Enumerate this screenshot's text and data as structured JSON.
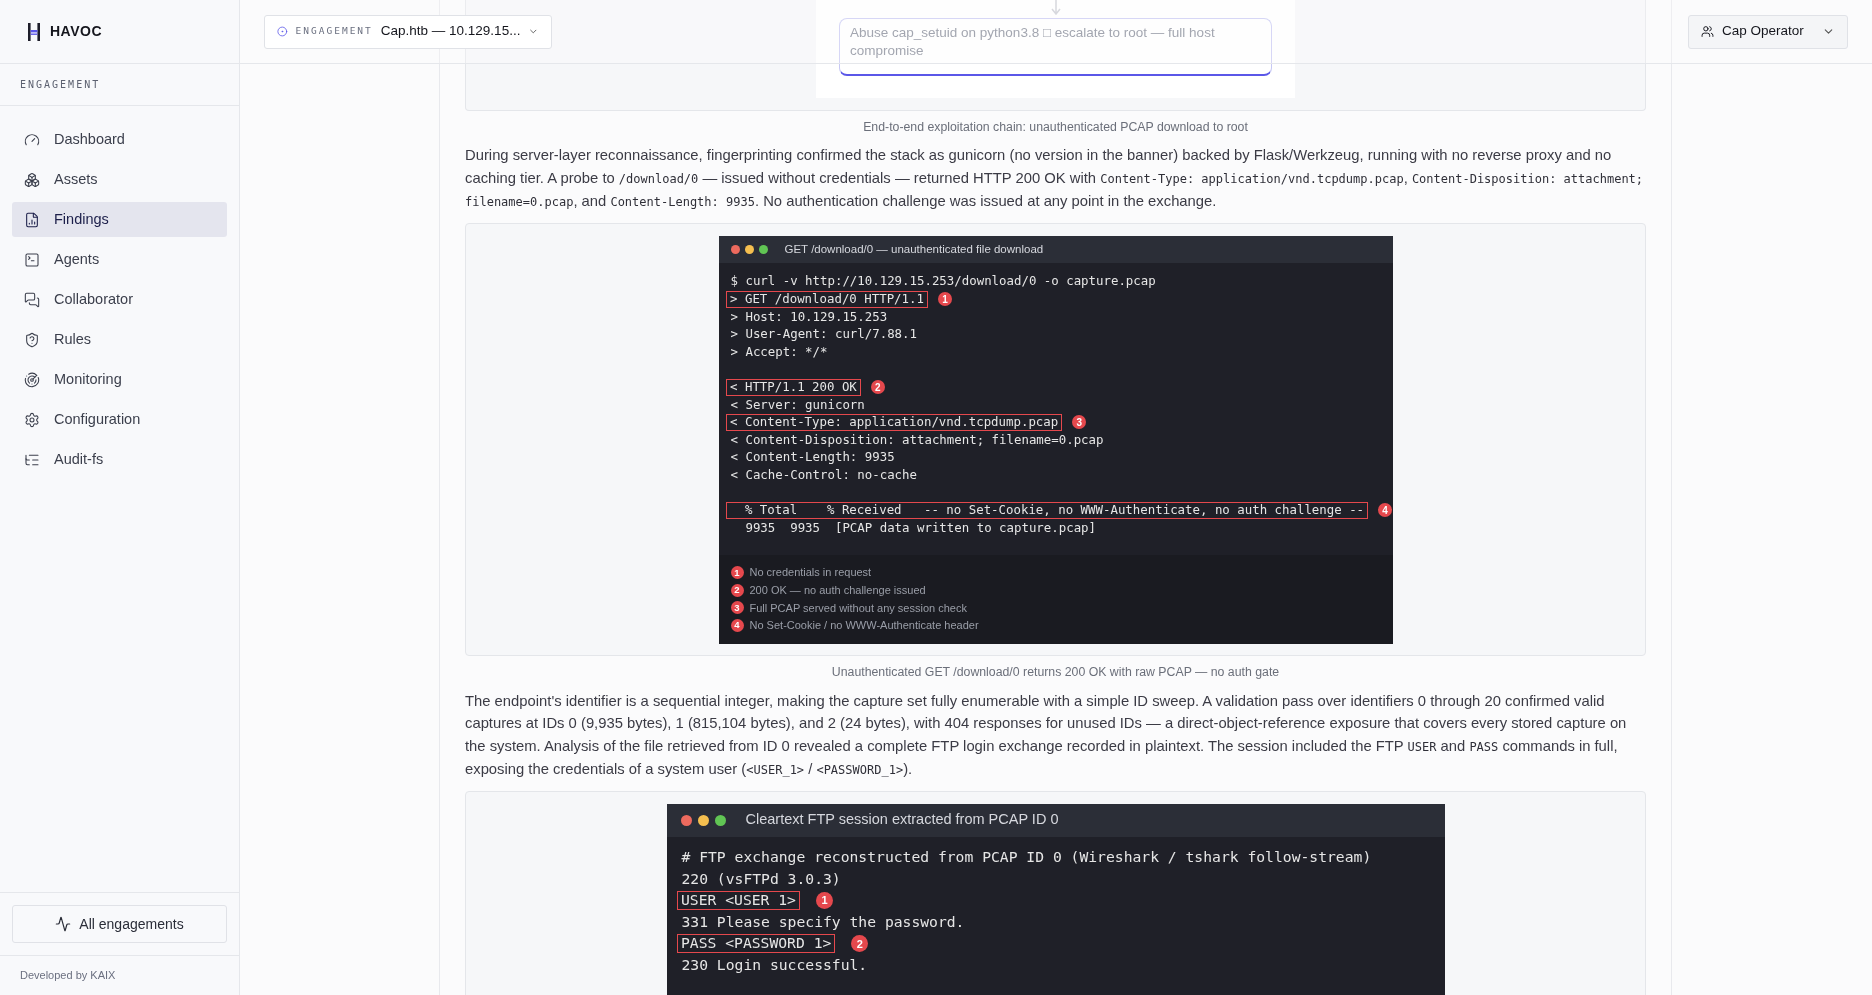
{
  "brand": {
    "name": "HAVOC"
  },
  "header": {
    "engagement": {
      "label": "ENGAGEMENT",
      "value": "Cap.htb — 10.129.15..."
    },
    "operator": "Cap Operator"
  },
  "sidebar": {
    "section": "ENGAGEMENT",
    "items": [
      {
        "label": "Dashboard",
        "selected": false
      },
      {
        "label": "Assets",
        "selected": false
      },
      {
        "label": "Findings",
        "selected": true
      },
      {
        "label": "Agents",
        "selected": false
      },
      {
        "label": "Collaborator",
        "selected": false
      },
      {
        "label": "Rules",
        "selected": false
      },
      {
        "label": "Monitoring",
        "selected": false
      },
      {
        "label": "Configuration",
        "selected": false
      },
      {
        "label": "Audit-fs",
        "selected": false
      }
    ],
    "button": "All engagements",
    "footer": "Developed by KAIX"
  },
  "blocks": [
    {
      "kind": "diagram",
      "node": "Abuse cap_setuid on python3.8 □ escalate to root — full host compromise",
      "caption": "End-to-end exploitation chain: unauthenticated PCAP download to root"
    },
    {
      "kind": "paragraph",
      "segments": [
        {
          "kind": "text",
          "text": "During server-layer reconnaissance, fingerprinting confirmed the stack as gunicorn (no version in the banner) backed by Flask/Werkzeug, running with no reverse proxy and no caching tier. A probe to "
        },
        {
          "kind": "code",
          "text": "/download/0"
        },
        {
          "kind": "text",
          "text": " — issued without credentials — returned HTTP 200 OK with "
        },
        {
          "kind": "code",
          "text": "Content-Type: application/vnd.tcpdump.pcap"
        },
        {
          "kind": "text",
          "text": ", "
        },
        {
          "kind": "code",
          "text": "Content-Disposition: attachment; filename=0.pcap"
        },
        {
          "kind": "text",
          "text": ", and "
        },
        {
          "kind": "code",
          "text": "Content-Length: 9935"
        },
        {
          "kind": "text",
          "text": ". No authentication challenge was issued at any point in the exchange."
        }
      ]
    },
    {
      "kind": "terminal",
      "title": "GET /download/0 — unauthenticated file download",
      "lines": [
        {
          "kind": "line",
          "text": "$ curl -v http://10.129.15.253/download/0 -o capture.pcap"
        },
        {
          "kind": "line",
          "text": "> GET /download/0 HTTP/1.1",
          "callout": "1"
        },
        {
          "kind": "line",
          "text": "> Host: 10.129.15.253"
        },
        {
          "kind": "line",
          "text": "> User-Agent: curl/7.88.1"
        },
        {
          "kind": "line",
          "text": "> Accept: */*"
        },
        {
          "kind": "blank"
        },
        {
          "kind": "line",
          "text": "< HTTP/1.1 200 OK",
          "callout": "2"
        },
        {
          "kind": "line",
          "text": "< Server: gunicorn"
        },
        {
          "kind": "line",
          "text": "< Content-Type: application/vnd.tcpdump.pcap",
          "callout": "3"
        },
        {
          "kind": "line",
          "text": "< Content-Disposition: attachment; filename=0.pcap"
        },
        {
          "kind": "line",
          "text": "< Content-Length: 9935"
        },
        {
          "kind": "line",
          "text": "< Cache-Control: no-cache"
        },
        {
          "kind": "blank"
        },
        {
          "kind": "line",
          "text": "  % Total    % Received   -- no Set-Cookie, no WWW-Authenticate, no auth challenge --",
          "callout": "4"
        },
        {
          "kind": "line",
          "text": "  9935  9935  [PCAP data written to capture.pcap]"
        }
      ],
      "legend": [
        {
          "number": "1",
          "text": "No credentials in request"
        },
        {
          "number": "2",
          "text": "200 OK — no auth challenge issued"
        },
        {
          "number": "3",
          "text": "Full PCAP served without any session check"
        },
        {
          "number": "4",
          "text": "No Set-Cookie / no WWW-Authenticate header"
        }
      ],
      "caption": "Unauthenticated GET /download/0 returns 200 OK with raw PCAP — no auth gate"
    },
    {
      "kind": "paragraph",
      "segments": [
        {
          "kind": "text",
          "text": "The endpoint's identifier is a sequential integer, making the capture set fully enumerable with a simple ID sweep. A validation pass over identifiers 0 through 20 confirmed valid captures at IDs 0 (9,935 bytes), 1 (815,104 bytes), and 2 (24 bytes), with 404 responses for unused IDs — a direct-object-reference exposure that covers every stored capture on the system. Analysis of the file retrieved from ID 0 revealed a complete FTP login exchange recorded in plaintext. The session included the FTP "
        },
        {
          "kind": "code",
          "text": "USER"
        },
        {
          "kind": "text",
          "text": " and "
        },
        {
          "kind": "code",
          "text": "PASS"
        },
        {
          "kind": "text",
          "text": " commands in full, exposing the credentials of a system user ("
        },
        {
          "kind": "code",
          "text": "<USER_1>"
        },
        {
          "kind": "text",
          "text": " / "
        },
        {
          "kind": "code",
          "text": "<PASSWORD_1>"
        },
        {
          "kind": "text",
          "text": ")."
        }
      ]
    },
    {
      "kind": "terminal",
      "title": "Cleartext FTP session extracted from PCAP ID 0",
      "lines": [
        {
          "kind": "line",
          "text": "# FTP exchange reconstructed from PCAP ID 0 (Wireshark / tshark follow-stream)"
        },
        {
          "kind": "line",
          "text": "220 (vsFTPd 3.0.3)"
        },
        {
          "kind": "line",
          "text": "USER <USER 1>",
          "callout": "1"
        },
        {
          "kind": "line",
          "text": "331 Please specify the password."
        },
        {
          "kind": "line",
          "text": "PASS <PASSWORD 1>",
          "callout": "2"
        },
        {
          "kind": "line",
          "text": "230 Login successful."
        }
      ]
    }
  ]
}
